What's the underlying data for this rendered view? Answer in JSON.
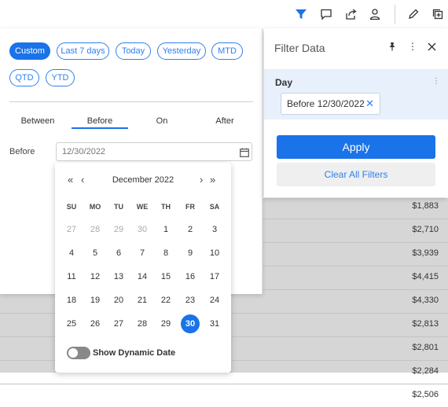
{
  "toolbar": {
    "icons": [
      "filter-icon",
      "comment-icon",
      "share-icon",
      "user-icon",
      "edit-icon",
      "add-widget-icon"
    ],
    "accent": "#1a73e8"
  },
  "table": {
    "amounts": [
      "$1,883",
      "$2,710",
      "$3,939",
      "$4,415",
      "$4,330",
      "$2,813",
      "$2,801",
      "$2,284",
      "$2,506"
    ]
  },
  "date_panel": {
    "presets": [
      "Custom",
      "Last 7 days",
      "Today",
      "Yesterday",
      "MTD",
      "QTD",
      "YTD"
    ],
    "active_preset": "Custom",
    "modes": [
      "Between",
      "Before",
      "On",
      "After"
    ],
    "active_mode": "Before",
    "field_label": "Before",
    "field_value": "12/30/2022"
  },
  "calendar": {
    "month_label": "December 2022",
    "weekdays": [
      "SU",
      "MO",
      "TU",
      "WE",
      "TH",
      "FR",
      "SA"
    ],
    "weeks": [
      [
        "27",
        "28",
        "29",
        "30",
        "1",
        "2",
        "3"
      ],
      [
        "4",
        "5",
        "6",
        "7",
        "8",
        "9",
        "10"
      ],
      [
        "11",
        "12",
        "13",
        "14",
        "15",
        "16",
        "17"
      ],
      [
        "18",
        "19",
        "20",
        "21",
        "22",
        "23",
        "24"
      ],
      [
        "25",
        "26",
        "27",
        "28",
        "29",
        "30",
        "31"
      ]
    ],
    "muted_first_row_count": 4,
    "selected_day": "30",
    "toggle_label": "Show Dynamic Date",
    "toggle_on": false
  },
  "filter_panel": {
    "title": "Filter Data",
    "section_label": "Day",
    "tag_text": "Before 12/30/2022",
    "apply_label": "Apply",
    "clear_label": "Clear All Filters"
  }
}
